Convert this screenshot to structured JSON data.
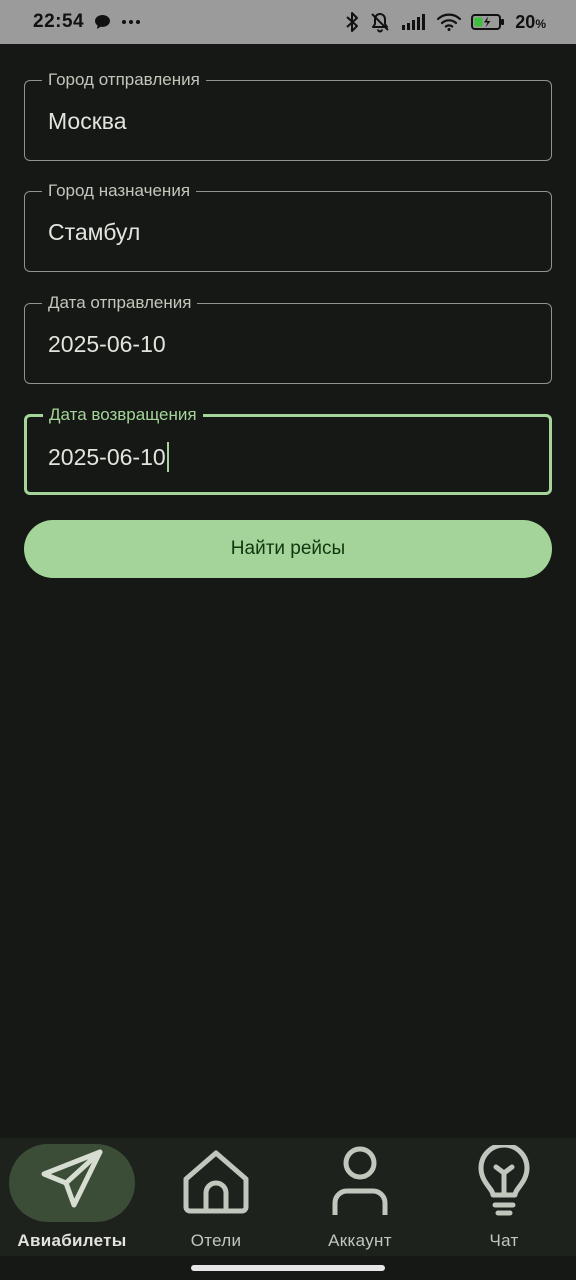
{
  "status_bar": {
    "time": "22:54",
    "battery": "20",
    "battery_unit": "%",
    "icons": [
      "chat-bubble-icon",
      "more-dots-icon",
      "bluetooth-icon",
      "bell-muted-icon",
      "signal-icon",
      "wifi-icon",
      "battery-charging-icon"
    ]
  },
  "form": {
    "origin": {
      "label": "Город отправления",
      "value": "Москва"
    },
    "destination": {
      "label": "Город назначения",
      "value": "Стамбул"
    },
    "departure_date": {
      "label": "Дата отправления",
      "value": "2025-06-10"
    },
    "return_date": {
      "label": "Дата возвращения",
      "value": "2025-06-10"
    },
    "search_button": "Найти рейсы"
  },
  "nav": {
    "items": [
      {
        "label": "Авиабилеты",
        "icon": "paper-plane-icon",
        "active": true
      },
      {
        "label": "Отели",
        "icon": "home-icon",
        "active": false
      },
      {
        "label": "Аккаунт",
        "icon": "person-icon",
        "active": false
      },
      {
        "label": "Чат",
        "icon": "lightbulb-icon",
        "active": false
      }
    ]
  },
  "colors": {
    "background": "#151814",
    "accent": "#a4d49a",
    "nav_background": "#1e221d",
    "active_pill": "#3b4c37",
    "status_bar": "#9b9b9b"
  }
}
